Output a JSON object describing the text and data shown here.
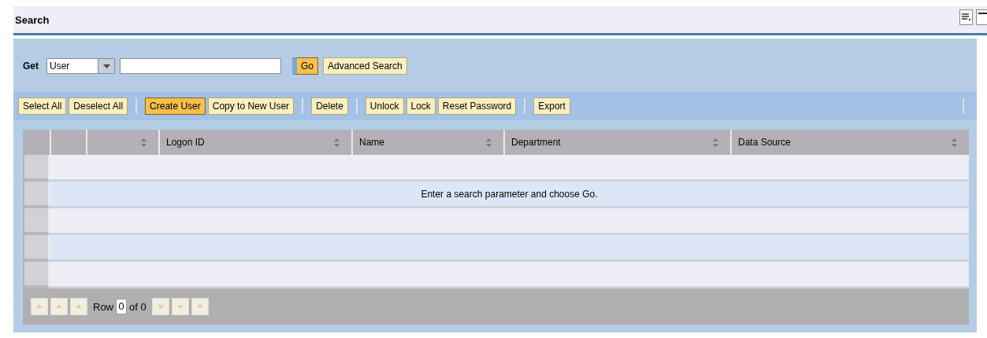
{
  "title": "Search",
  "search": {
    "label": "Get",
    "type_select": {
      "value": "User"
    },
    "buttons": [
      {
        "label": "Go",
        "emphasized": true
      },
      {
        "label": "Advanced Search",
        "emphasized": false
      }
    ]
  },
  "toolbar": {
    "groups": [
      [
        {
          "label": "Select All",
          "emphasized": false
        },
        {
          "label": "Deselect All",
          "emphasized": false
        }
      ],
      [
        {
          "label": "Create User",
          "emphasized": true
        },
        {
          "label": "Copy to New User",
          "emphasized": false
        }
      ],
      [
        {
          "label": "Delete",
          "emphasized": false
        }
      ],
      [
        {
          "label": "Unlock",
          "emphasized": false
        },
        {
          "label": "Lock",
          "emphasized": false
        },
        {
          "label": "Reset Password",
          "emphasized": false
        }
      ],
      [
        {
          "label": "Export",
          "emphasized": false
        }
      ]
    ]
  },
  "table": {
    "columns": [
      {
        "sortable": false
      },
      {
        "sortable": true
      },
      {
        "label": "Logon ID",
        "sortable": true
      },
      {
        "label": "Name",
        "sortable": true
      },
      {
        "label": "Department",
        "sortable": true
      },
      {
        "label": "Data Source",
        "sortable": true
      }
    ],
    "rows": [
      {},
      {
        "message": "Enter a search parameter and choose Go."
      },
      {},
      {},
      {}
    ],
    "pager": {
      "row_label": "Row",
      "row_value": "0",
      "total_label": "of 0",
      "nav_disabled": true
    }
  }
}
